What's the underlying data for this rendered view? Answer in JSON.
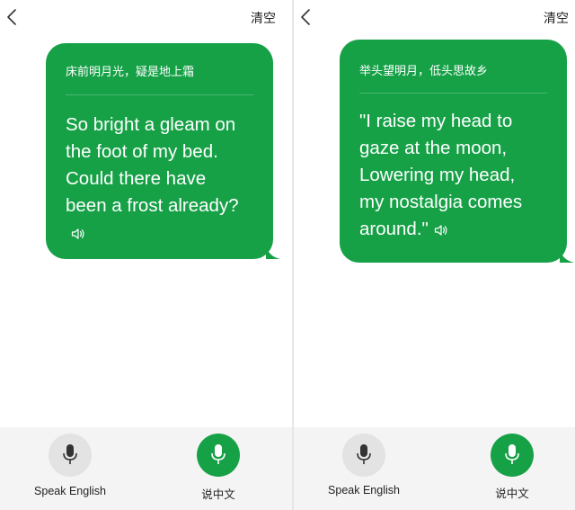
{
  "colors": {
    "accent_green": "#16a147",
    "divider": "#e6e6e6",
    "bottom_bar": "#f4f4f4",
    "grey_button": "#e3e3e3"
  },
  "left_panel": {
    "header": {
      "back_icon": "chevron-left-icon",
      "clear_label": "清空"
    },
    "bubble": {
      "chinese_text": "床前明月光，疑是地上霜",
      "english_lines": [
        "So bright a gleam on",
        "the foot of my bed.",
        "Could there have",
        "been a frost already?"
      ],
      "speaker_icon": "speaker-icon"
    },
    "bottom": {
      "english_button": {
        "icon": "microphone-icon",
        "label": "Speak English"
      },
      "chinese_button": {
        "icon": "microphone-icon",
        "label": "说中文"
      }
    }
  },
  "right_panel": {
    "header": {
      "back_icon": "chevron-left-icon",
      "clear_label": "清空"
    },
    "bubble": {
      "chinese_text": "举头望明月，低头思故乡",
      "english_lines": [
        "\"I raise my head to",
        "gaze at the moon,",
        "Lowering my head,",
        "my nostalgia comes",
        "around.\""
      ],
      "speaker_icon": "speaker-icon"
    },
    "bottom": {
      "english_button": {
        "icon": "microphone-icon",
        "label": "Speak English"
      },
      "chinese_button": {
        "icon": "microphone-icon",
        "label": "说中文"
      }
    }
  }
}
